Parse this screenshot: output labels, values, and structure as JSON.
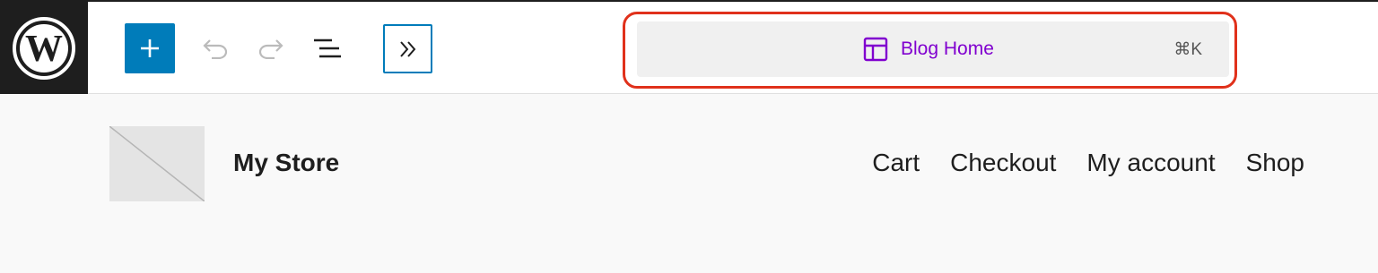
{
  "toolbar": {
    "logo_icon": "wordpress-logo-icon",
    "add_icon": "plus-icon",
    "undo_icon": "undo-icon",
    "redo_icon": "redo-icon",
    "list_view_icon": "list-view-icon",
    "collapse_icon": "chevron-double-right-icon",
    "accent_color": "#007cba"
  },
  "command_bar": {
    "icon": "layout-icon",
    "title": "Blog Home",
    "shortcut": "⌘K",
    "title_color": "#8000cf",
    "highlight_color": "#e0311b"
  },
  "site": {
    "logo": "site-logo-placeholder",
    "title": "My Store",
    "nav": [
      "Cart",
      "Checkout",
      "My account",
      "Shop"
    ]
  }
}
